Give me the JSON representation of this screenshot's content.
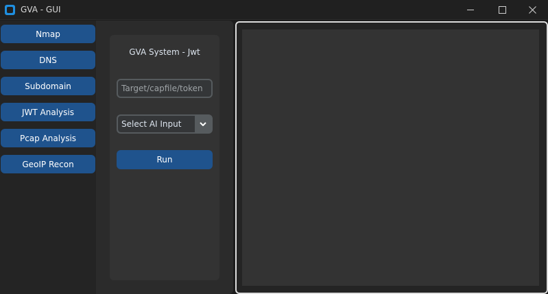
{
  "window": {
    "title": "GVA - GUI",
    "icon": "app-icon",
    "controls": [
      "minimize-icon",
      "maximize-icon",
      "close-icon"
    ]
  },
  "sidebar": {
    "items": [
      {
        "label": "Nmap"
      },
      {
        "label": "DNS"
      },
      {
        "label": "Subdomain"
      },
      {
        "label": "JWT Analysis"
      },
      {
        "label": "Pcap Analysis"
      },
      {
        "label": "GeoIP Recon"
      }
    ]
  },
  "panel": {
    "title": "GVA System - Jwt",
    "target_placeholder": "Target/capfile/token",
    "target_value": "",
    "ai_select_value": "Select AI Input",
    "run_label": "Run"
  },
  "output": {
    "text": ""
  },
  "colors": {
    "accent": "#1f538d",
    "background": "#242424",
    "panel": "#333333",
    "input_border": "#565b5e"
  }
}
